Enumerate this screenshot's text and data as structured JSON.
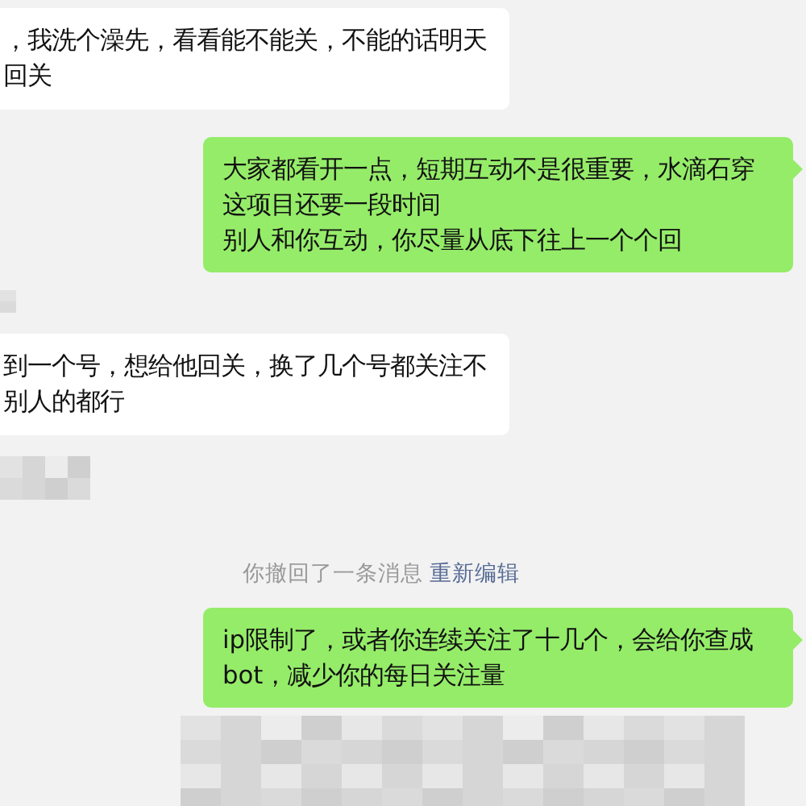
{
  "messages": [
    {
      "kind": "incoming",
      "text": "，我洗个澡先，看看能不能关，不能的话明天回关"
    },
    {
      "kind": "outgoing",
      "paragraphs": [
        "大家都看开一点，短期互动不是很重要，水滴石穿这项目还要一段时间",
        "别人和你互动，你尽量从底下往上一个个回"
      ]
    },
    {
      "kind": "redacted"
    },
    {
      "kind": "incoming",
      "text": "到一个号，想给他回关，换了几个号都关注不别人的都行"
    },
    {
      "kind": "redacted"
    },
    {
      "kind": "notice",
      "text": "你撤回了一条消息",
      "link": "重新编辑"
    },
    {
      "kind": "outgoing",
      "paragraphs": [
        "ip限制了，或者你连续关注了十几个，会给你查成bot，减少你的每日关注量"
      ]
    },
    {
      "kind": "redacted"
    }
  ]
}
